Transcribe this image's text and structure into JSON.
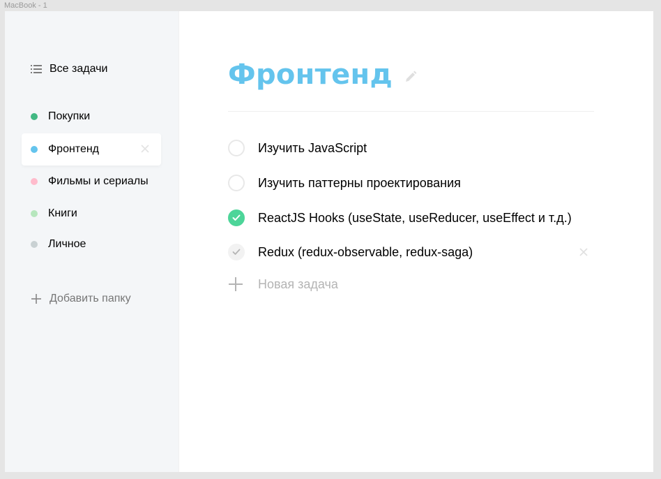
{
  "frame": {
    "label": "MacBook - 1"
  },
  "sidebar": {
    "all_tasks_label": "Все задачи",
    "lists": [
      {
        "label": "Покупки",
        "color": "#42b883"
      },
      {
        "label": "Фронтенд",
        "color": "#64c4ed",
        "active": true
      },
      {
        "label": "Фильмы и сериалы",
        "color": "#ffbbcc"
      },
      {
        "label": "Книги",
        "color": "#b6e6bd"
      },
      {
        "label": "Личное",
        "color": "#c9d1d3"
      }
    ],
    "add_folder_label": "Добавить папку"
  },
  "main": {
    "title": "Фронтенд",
    "title_color": "#64c4ed",
    "tasks": [
      {
        "text": "Изучить JavaScript",
        "completed": false
      },
      {
        "text": "Изучить паттерны проектирования",
        "completed": false
      },
      {
        "text": "ReactJS Hooks (useState, useReducer, useEffect и т.д.)",
        "completed": true
      },
      {
        "text": "Redux (redux-observable, redux-saga)",
        "completed": false,
        "hovered": true
      }
    ],
    "new_task_placeholder": "Новая задача"
  },
  "colors": {
    "completed_check": "#4dd599",
    "sidebar_bg": "#f4f6f8"
  }
}
